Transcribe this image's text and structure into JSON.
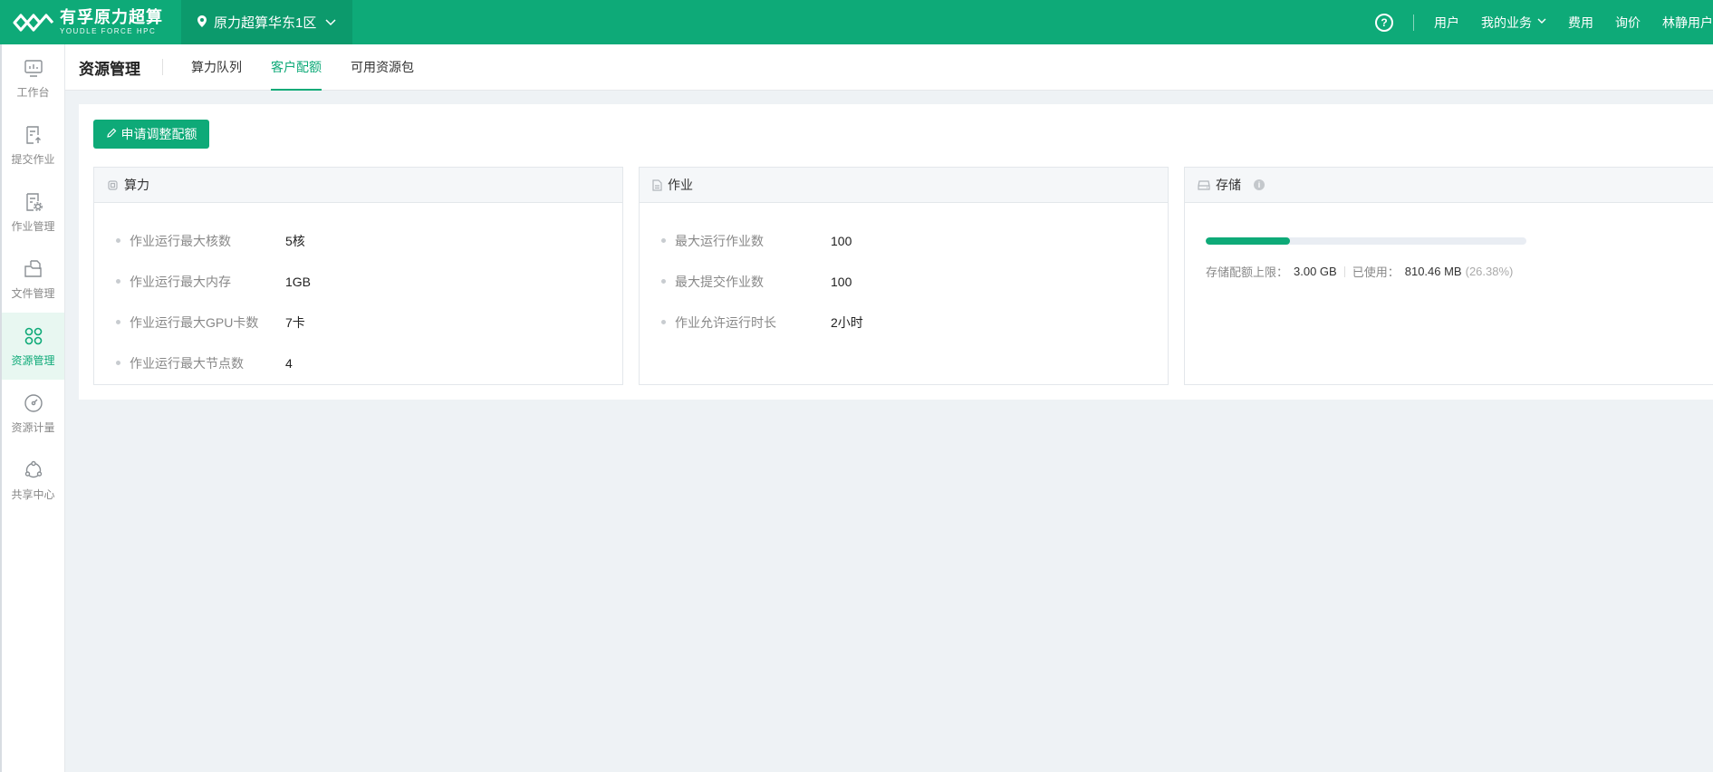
{
  "brand": {
    "name": "有孚原力超算",
    "subtitle": "YOUDLE FORCE HPC"
  },
  "region": {
    "label": "原力超算华东1区"
  },
  "top_nav": {
    "items": [
      "用户",
      "我的业务",
      "费用",
      "询价",
      "林静用户"
    ],
    "help_icon": "question-circle-icon"
  },
  "sidebar": {
    "items": [
      {
        "label": "工作台",
        "icon": "monitor-chart-icon",
        "active": false
      },
      {
        "label": "提交作业",
        "icon": "upload-doc-icon",
        "active": false
      },
      {
        "label": "作业管理",
        "icon": "doc-gear-icon",
        "active": false
      },
      {
        "label": "文件管理",
        "icon": "folder-doc-icon",
        "active": false
      },
      {
        "label": "资源管理",
        "icon": "four-circles-icon",
        "active": true
      },
      {
        "label": "资源计量",
        "icon": "gauge-icon",
        "active": false
      },
      {
        "label": "共享中心",
        "icon": "share-cycle-icon",
        "active": false
      }
    ]
  },
  "subnav": {
    "title": "资源管理",
    "tabs": [
      {
        "label": "算力队列",
        "active": false
      },
      {
        "label": "客户配额",
        "active": true
      },
      {
        "label": "可用资源包",
        "active": false
      }
    ]
  },
  "actions": {
    "apply_label": "申请调整配额"
  },
  "cards": {
    "compute": {
      "title": "算力",
      "rows": [
        {
          "label": "作业运行最大核数",
          "value": "5核"
        },
        {
          "label": "作业运行最大内存",
          "value": "1GB"
        },
        {
          "label": "作业运行最大GPU卡数",
          "value": "7卡"
        },
        {
          "label": "作业运行最大节点数",
          "value": "4"
        }
      ]
    },
    "jobs": {
      "title": "作业",
      "rows": [
        {
          "label": "最大运行作业数",
          "value": "100"
        },
        {
          "label": "最大提交作业数",
          "value": "100"
        },
        {
          "label": "作业允许运行时长",
          "value": "2小时"
        }
      ]
    },
    "storage": {
      "title": "存储",
      "quota_label": "存储配额上限：",
      "quota_value": "3.00 GB",
      "used_label": "已使用：",
      "used_value": "810.46 MB",
      "used_percent_text": "(26.38%)",
      "used_fraction": 0.2638
    }
  },
  "colors": {
    "primary": "#0eaa78",
    "primary_dark": "#0c9a6c",
    "background": "#eef2f5"
  }
}
